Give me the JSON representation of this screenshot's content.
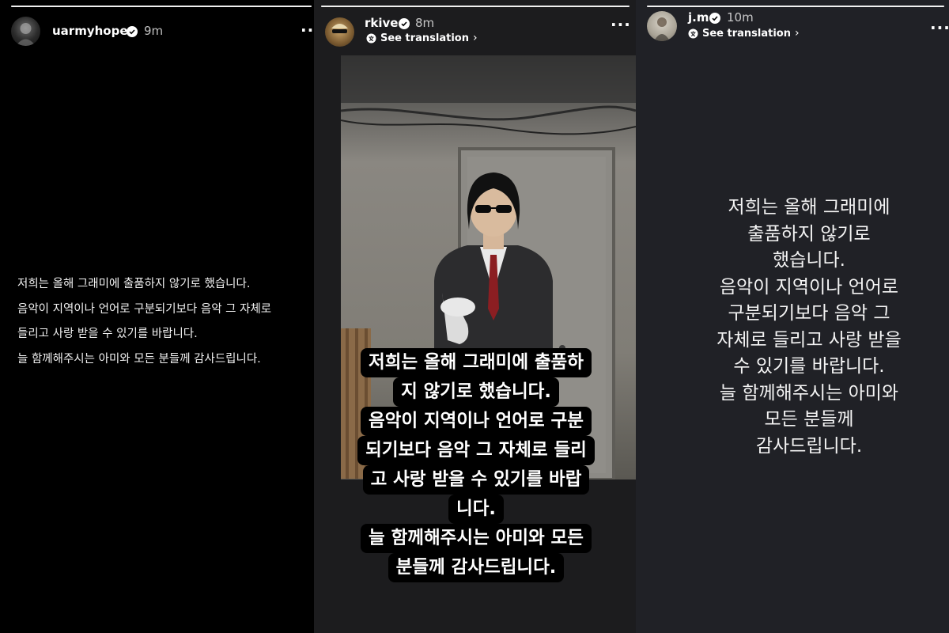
{
  "stories": [
    {
      "username": "uarmyhope",
      "time": "9m",
      "text_lines": [
        "저희는 올해 그래미에 출품하지 않기로 했습니다.",
        "음악이 지역이나 언어로 구분되기보다 음악 그 자체로",
        "들리고 사랑 받을 수 있기를 바랍니다.",
        "늘 함께해주시는 아미와 모든 분들께 감사드립니다."
      ]
    },
    {
      "username": "rkive",
      "time": "8m",
      "see_translation": "See translation",
      "caption_lines": [
        "저희는 올해 그래미에 출품하",
        "지 않기로 했습니다.",
        "음악이 지역이나 언어로 구분",
        "되기보다 음악 그 자체로 들리",
        "고 사랑 받을 수 있기를 바랍",
        "니다.",
        "늘 함께해주시는 아미와 모든",
        "분들께 감사드립니다."
      ]
    },
    {
      "username": "j.m",
      "time": "10m",
      "see_translation": "See translation",
      "text_lines": [
        "저희는 올해 그래미에",
        "출품하지 않기로",
        "했습니다.",
        "음악이 지역이나 언어로",
        "구분되기보다 음악 그",
        "자체로 들리고 사랑 받을",
        "수 있기를 바랍니다.",
        "늘 함께해주시는 아미와",
        "모든 분들께",
        "감사드립니다."
      ]
    }
  ],
  "colors": {
    "verified_badge": "#3897f0",
    "story_bg_1": "#000000",
    "story_bg_2": "#1c1c1e",
    "story_bg_3": "#202126"
  },
  "icons": [
    "verified-badge-icon",
    "more-options-icon",
    "translate-icon",
    "chevron-right-icon"
  ]
}
